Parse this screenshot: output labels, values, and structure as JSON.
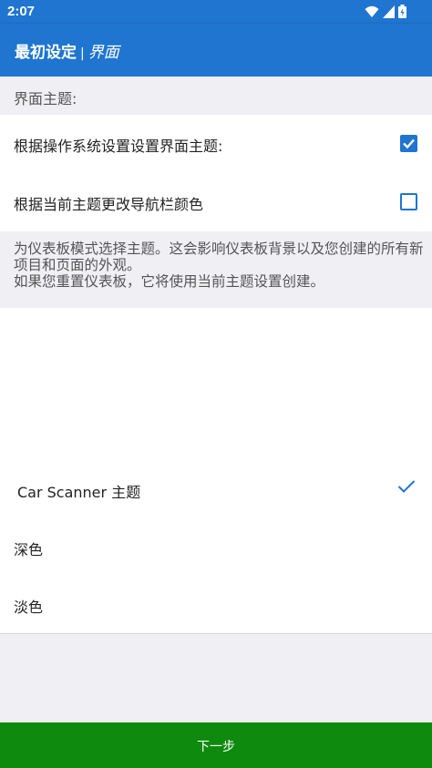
{
  "status_bar": {
    "time": "2:07"
  },
  "app_bar": {
    "title": "最初设定",
    "separator": "|",
    "subtitle": "界面"
  },
  "section": {
    "header": "界面主题:"
  },
  "settings": [
    {
      "label": "根据操作系统设置设置界面主题:",
      "checked": true
    },
    {
      "label": "根据当前主题更改导航栏颜色",
      "checked": false
    }
  ],
  "note": {
    "line1": "为仪表板模式选择主题。这会影响仪表板背景以及您创建的所有新项目和页面的外观。",
    "line2": "如果您重置仪表板，它将使用当前主题设置创建。"
  },
  "themes": {
    "selected": "Car Scanner 主题",
    "options": [
      "Car Scanner 主题",
      "深色",
      "淡色"
    ]
  },
  "footer": {
    "next_label": "下一步"
  },
  "colors": {
    "primary": "#1f75cf",
    "button_green": "#0e8a0e"
  }
}
